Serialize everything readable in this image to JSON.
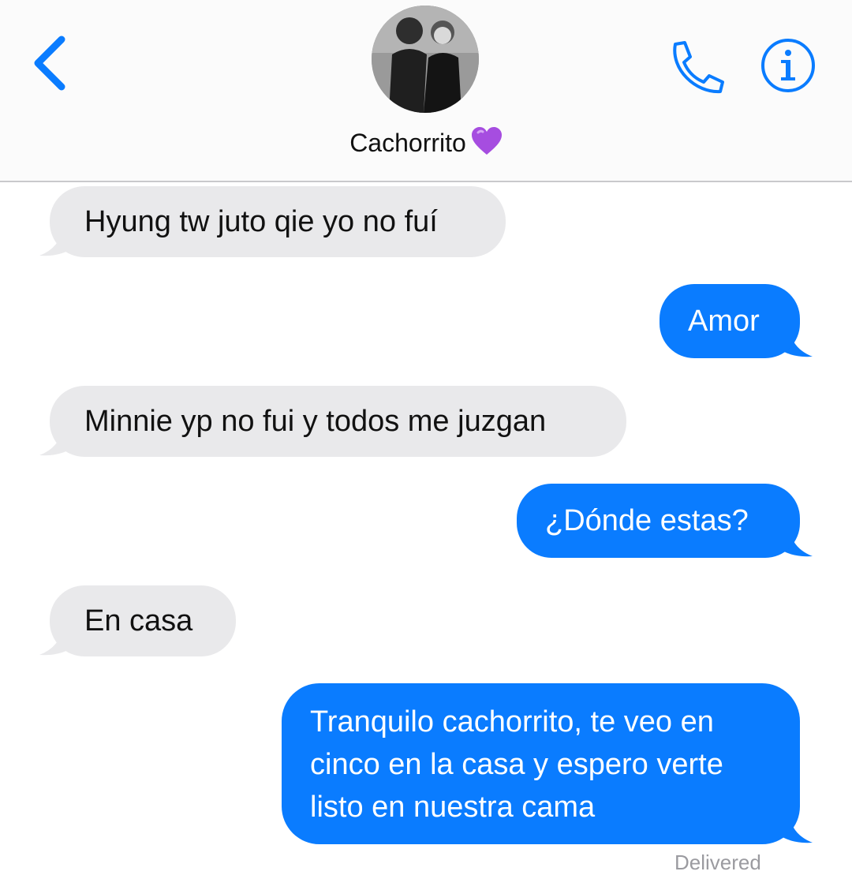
{
  "header": {
    "contact_name": "Cachorrito",
    "contact_emoji": "💜"
  },
  "messages": [
    {
      "direction": "received",
      "text": "Hyung tw juto qie yo no fuí"
    },
    {
      "direction": "sent",
      "text": "Amor"
    },
    {
      "direction": "received",
      "text": "Minnie yp no fui y todos me juzgan"
    },
    {
      "direction": "sent",
      "text": "¿Dónde estas?"
    },
    {
      "direction": "received",
      "text": "En casa"
    },
    {
      "direction": "sent",
      "text": "Tranquilo cachorrito, te veo en cinco en la casa y espero verte listo en nuestra cama"
    }
  ],
  "status": {
    "delivered": "Delivered"
  },
  "colors": {
    "accent": "#0a7cff",
    "received_bubble": "#e9e9eb",
    "sent_bubble": "#0a7cff"
  },
  "icons": [
    "chevron-left-icon",
    "phone-icon",
    "info-icon",
    "purple-heart-emoji"
  ]
}
